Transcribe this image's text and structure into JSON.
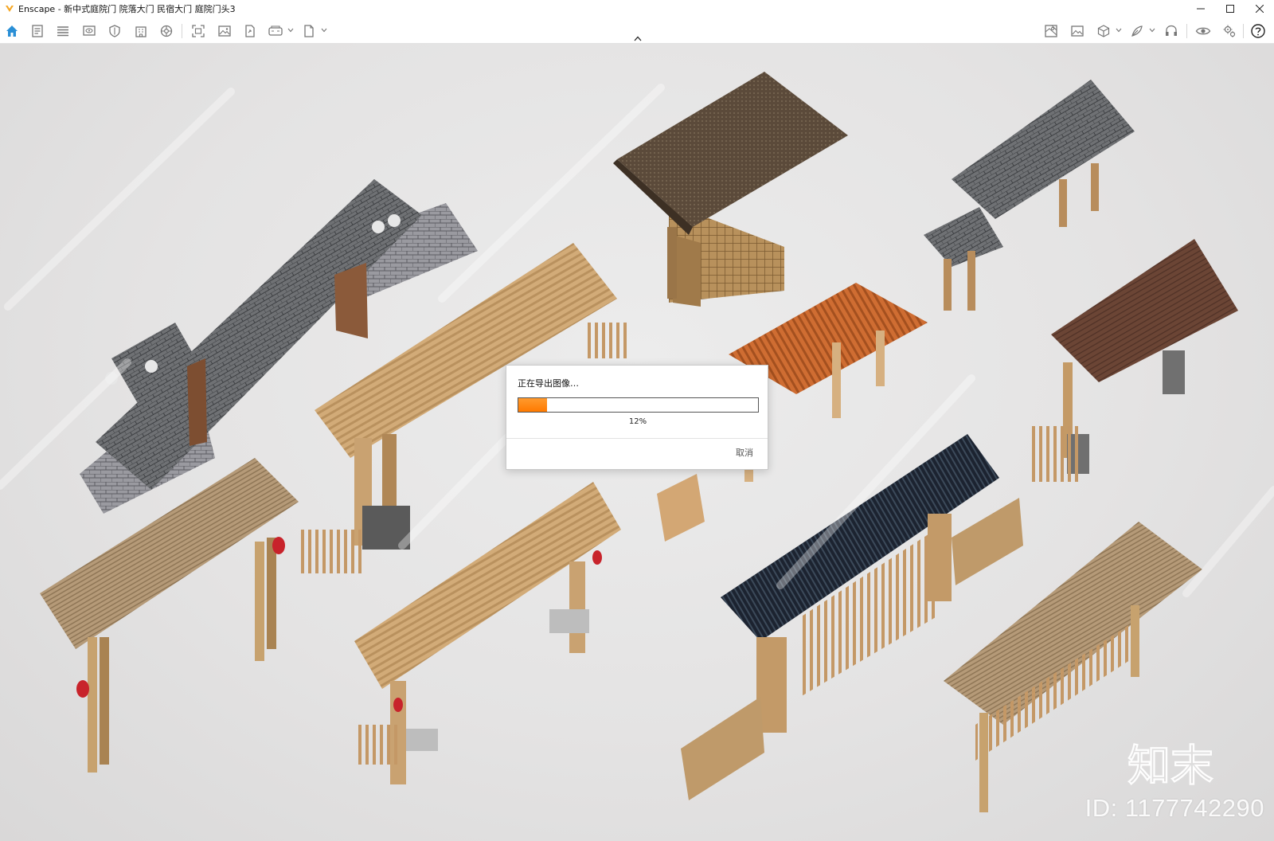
{
  "window": {
    "title": "Enscape - 新中式庭院门 院落大门 民宿大门 庭院门头3",
    "controls": [
      "minimize",
      "maximize",
      "close"
    ]
  },
  "toolbar": {
    "left_icons": [
      "home-icon",
      "document-icon",
      "list-icon",
      "monitor-eye-icon",
      "shield-icon",
      "building-icon",
      "settings-wheel-icon",
      "capture-icon",
      "image-icon",
      "file-export-icon",
      "vr-icon",
      "document-dropdown-icon"
    ],
    "right_icons": [
      "map-icon",
      "gallery-icon",
      "cube-icon",
      "feather-icon",
      "headset-icon",
      "eye-icon",
      "gears-icon",
      "help-icon"
    ],
    "accent_color": "#2a8fd6"
  },
  "export_dialog": {
    "title": "正在导出图像…",
    "progress": 0.12,
    "percent_label": "12%",
    "cancel_label": "取消",
    "progress_color": "#ff8a14"
  },
  "watermark": {
    "logo_text": "知末",
    "id_label": "ID: 1177742290"
  }
}
